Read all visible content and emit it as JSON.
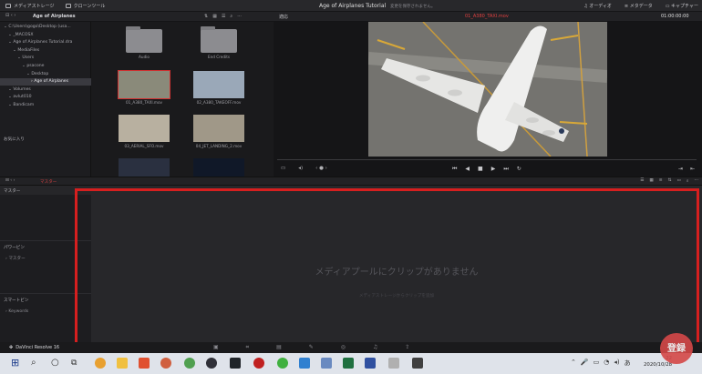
{
  "topbar": {
    "media_storage": "メディアストレージ",
    "clone_tool": "クローンツール",
    "project_title": "Age of Airplanes Tutorial",
    "unsaved": "変更を保存されません。",
    "audio": "オーディオ",
    "metadata": "メタデータ",
    "capture": "キャプチャー"
  },
  "toolbar2": {
    "path": "Age of Airplanes",
    "zoom": "適応",
    "clip_name": "01_A380_TAXI.mov",
    "timecode": "01:00:00:00"
  },
  "tree": [
    {
      "label": "C:\\Users\\gogo\\Desktop (usa...",
      "indent": 0
    },
    {
      "label": "_MACOSX",
      "indent": 1
    },
    {
      "label": "Age of Airplanes Tutorial.dra",
      "indent": 1
    },
    {
      "label": "MediaFiles",
      "indent": 2
    },
    {
      "label": "Users",
      "indent": 3
    },
    {
      "label": "psacone",
      "indent": 4
    },
    {
      "label": "Desktop",
      "indent": 5
    },
    {
      "label": "Age of Airplanes",
      "indent": 6,
      "selected": true
    },
    {
      "label": "Volumes",
      "indent": 1
    },
    {
      "label": "avlut010",
      "indent": 1
    },
    {
      "label": "Bandicam",
      "indent": 1
    }
  ],
  "favorites": "お気に入り",
  "media": [
    {
      "name": "Audio",
      "kind": "folder"
    },
    {
      "name": "End Credits",
      "kind": "folder"
    },
    {
      "name": "01_A380_TAXI.mov",
      "kind": "clip",
      "selected": true,
      "color": "#8a8a7a"
    },
    {
      "name": "02_A380_TAKEOFF.mov",
      "kind": "clip",
      "color": "#9aa8b8"
    },
    {
      "name": "03_AERIAL_SFO.mov",
      "kind": "clip",
      "color": "#b8b0a0"
    },
    {
      "name": "04_JET_LANDING_2.mov",
      "kind": "clip",
      "color": "#a09888"
    },
    {
      "name": "",
      "kind": "clip",
      "color": "#2a3040"
    },
    {
      "name": "",
      "kind": "clip",
      "color": "#101828"
    }
  ],
  "bottom": {
    "bin_header": "マスター",
    "master_label": "マスター",
    "power_bin": "パワービン",
    "power_master": "マスター",
    "smart_bin": "スマートビン",
    "keywords": "Keywords",
    "empty_message": "メディアプールにクリップがありません",
    "hint": "メディアストレージからクリップを追加"
  },
  "status": {
    "app": "DaVinci Resolve 16"
  },
  "taskbar": {
    "time": "22",
    "date": "2020/10/28",
    "badge": "登録"
  },
  "colors": {
    "accent_red": "#d61f1f",
    "panel_bg": "#1e1e20"
  }
}
